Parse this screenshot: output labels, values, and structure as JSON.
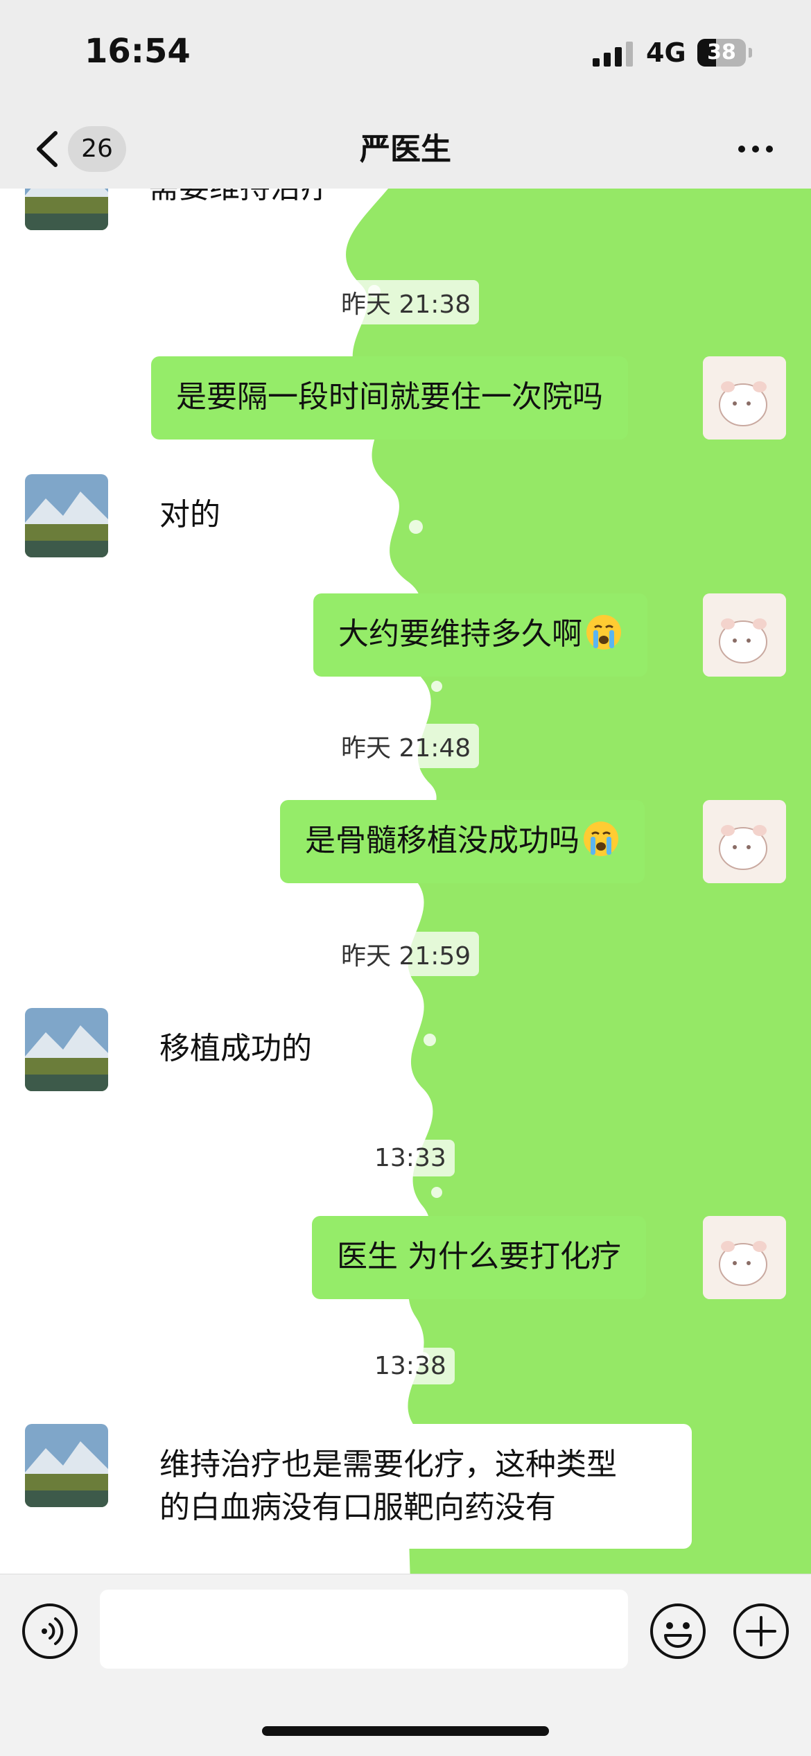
{
  "status_bar": {
    "time": "16:54",
    "network": "4G",
    "battery_level": "38",
    "battery_fraction": 0.38
  },
  "nav": {
    "unread_count": "26",
    "title": "严医生"
  },
  "messages": [
    {
      "type": "in",
      "text": "需要维持治疗"
    },
    {
      "type": "time",
      "text": "昨天 21:38"
    },
    {
      "type": "out",
      "text": "是要隔一段时间就要住一次院吗"
    },
    {
      "type": "in",
      "text": "对的"
    },
    {
      "type": "out",
      "text": "大约要维持多久啊",
      "emoji": "crying-face"
    },
    {
      "type": "time",
      "text": "昨天 21:48"
    },
    {
      "type": "out",
      "text": "是骨髓移植没成功吗",
      "emoji": "crying-face"
    },
    {
      "type": "time",
      "text": "昨天 21:59"
    },
    {
      "type": "in",
      "text": "移植成功的"
    },
    {
      "type": "time",
      "text": "13:33"
    },
    {
      "type": "out",
      "text": "医生 为什么要打化疗"
    },
    {
      "type": "time",
      "text": "13:38"
    },
    {
      "type": "in",
      "lines": [
        "维持治疗也是需要化疗，这种类型",
        "的白血病没有口服靶向药没有"
      ]
    }
  ],
  "input": {
    "value": "",
    "placeholder": ""
  },
  "colors": {
    "outgoing_bubble": "#95ec69",
    "incoming_bubble": "#ffffff",
    "wallpaper_green": "#95e866",
    "bar_background": "#ededed"
  },
  "icons": {
    "back": "chevron-left-icon",
    "more": "ellipsis-icon",
    "voice": "voice-icon",
    "emoji": "smiley-icon",
    "plus": "plus-icon"
  }
}
